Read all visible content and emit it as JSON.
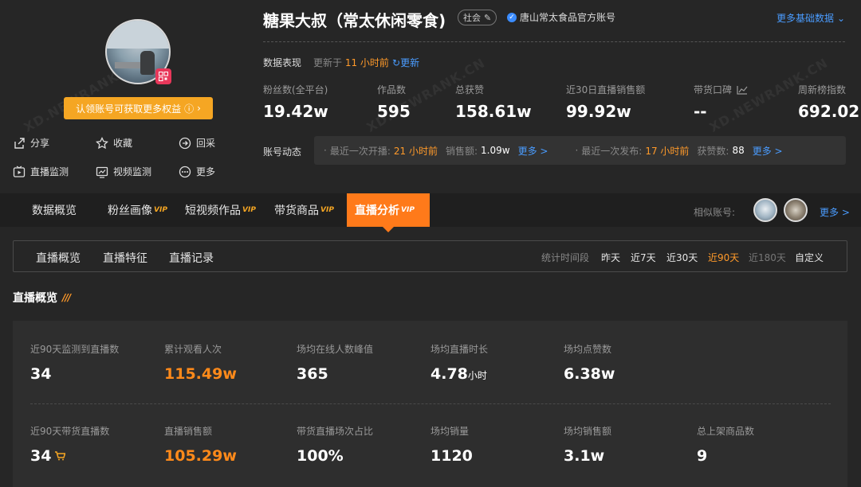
{
  "profile": {
    "claim_label": "认领账号可获取更多权益",
    "actions": [
      {
        "label": "分享",
        "icon": "share-icon"
      },
      {
        "label": "收藏",
        "icon": "star-icon"
      },
      {
        "label": "回采",
        "icon": "recollect-icon"
      },
      {
        "label": "直播监测",
        "icon": "live-monitor-icon"
      },
      {
        "label": "视频监测",
        "icon": "video-monitor-icon"
      },
      {
        "label": "更多",
        "icon": "more-icon"
      }
    ]
  },
  "header": {
    "title": "糖果大叔（常太休闲零食)",
    "tag": "社会",
    "verified_label": "唐山常太食品官方账号",
    "more_basic": "更多基础数据"
  },
  "performance": {
    "label": "数据表现",
    "updated_prefix": "更新于",
    "updated_value": "11 小时前",
    "refresh_label": "更新"
  },
  "stats": [
    {
      "label": "粉丝数(全平台)",
      "value": "19.42w"
    },
    {
      "label": "作品数",
      "value": "595"
    },
    {
      "label": "总获赞",
      "value": "158.61w"
    },
    {
      "label": "近30日直播销售额",
      "value": "99.92w"
    },
    {
      "label": "带货口碑",
      "value": "--"
    },
    {
      "label": "周新榜指数",
      "value": "692.02"
    }
  ],
  "dynamics": {
    "label": "账号动态",
    "live": {
      "prefix": "最近一次开播:",
      "time": "21 小时前",
      "sales_label": "销售额:",
      "sales": "1.09w",
      "more": "更多 >"
    },
    "post": {
      "prefix": "最近一次发布:",
      "time": "17 小时前",
      "likes_label": "获赞数:",
      "likes": "88",
      "more": "更多 >"
    }
  },
  "tabs": [
    {
      "label": "数据概览",
      "vip": ""
    },
    {
      "label": "粉丝画像",
      "vip": "VIP"
    },
    {
      "label": "短视频作品",
      "vip": "VIP"
    },
    {
      "label": "带货商品",
      "vip": "VIP"
    },
    {
      "label": "直播分析",
      "vip": "VIP"
    }
  ],
  "similar": {
    "label": "相似账号:",
    "more": "更多 >"
  },
  "subtabs": [
    "直播概览",
    "直播特征",
    "直播记录"
  ],
  "period": {
    "label": "统计时间段",
    "options": [
      "昨天",
      "近7天",
      "近30天",
      "近90天",
      "近180天",
      "自定义"
    ],
    "active": "近90天"
  },
  "section": {
    "title": "直播概览"
  },
  "metrics_row1": [
    {
      "label": "近90天监测到直播数",
      "value": "34"
    },
    {
      "label": "累计观看人次",
      "value": "115.49w"
    },
    {
      "label": "场均在线人数峰值",
      "value": "365"
    },
    {
      "label": "场均直播时长",
      "value": "4.78",
      "unit": "小时"
    },
    {
      "label": "场均点赞数",
      "value": "6.38w"
    }
  ],
  "metrics_row2": [
    {
      "label": "近90天带货直播数",
      "value": "34"
    },
    {
      "label": "直播销售额",
      "value": "105.29w"
    },
    {
      "label": "带货直播场次占比",
      "value": "100%"
    },
    {
      "label": "场均销量",
      "value": "1120"
    },
    {
      "label": "场均销售额",
      "value": "3.1w"
    },
    {
      "label": "总上架商品数",
      "value": "9"
    }
  ],
  "watermark": "XD.NEWRANK.CN",
  "colors": {
    "accent": "#ff7a1a",
    "link": "#4a9cff",
    "highlight": "#ff9a2a",
    "claim": "#f5a623"
  }
}
